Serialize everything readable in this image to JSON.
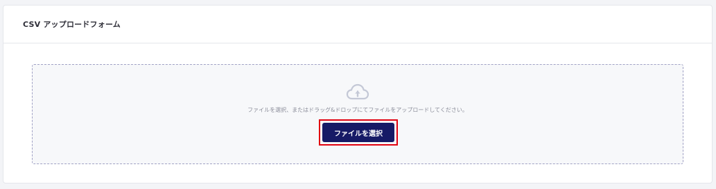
{
  "card": {
    "title": "CSV アップロードフォーム"
  },
  "dropzone": {
    "icon": "cloud-upload-icon",
    "instruction": "ファイルを選択、またはドラッグ&ドロップにてファイルをアップロードしてください。",
    "select_button_label": "ファイルを選択"
  },
  "colors": {
    "button_bg": "#161a66",
    "highlight_border": "#e1000f",
    "dropzone_border": "#9fa0c4",
    "icon": "#c4c8d6"
  }
}
